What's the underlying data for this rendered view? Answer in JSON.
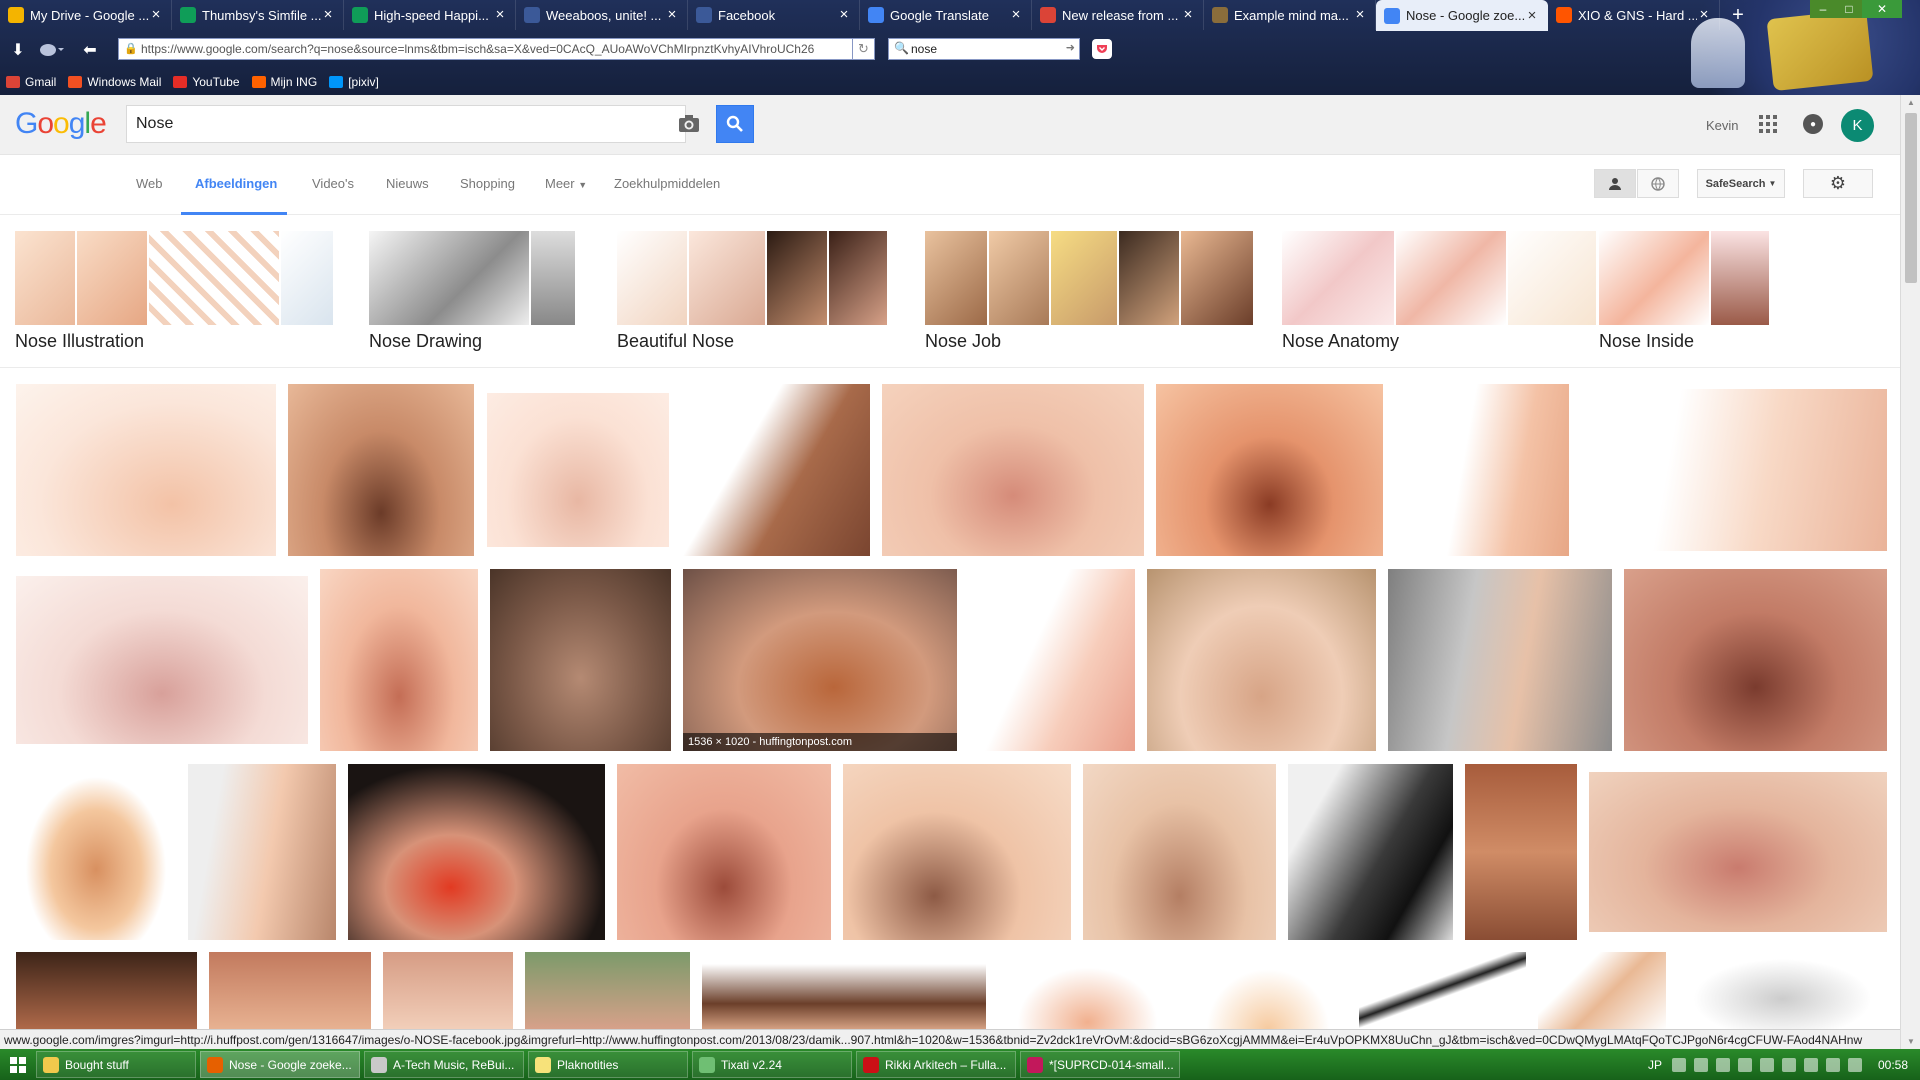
{
  "browser": {
    "tabs": [
      {
        "label": "My Drive - Google ...",
        "icon": "drive-icon",
        "color": "#f4b400"
      },
      {
        "label": "Thumbsy's Simfile ...",
        "icon": "sheet-icon",
        "color": "#0f9d58"
      },
      {
        "label": "High-speed Happi...",
        "icon": "sheet-icon",
        "color": "#0f9d58"
      },
      {
        "label": "Weeaboos, unite! ...",
        "icon": "facebook-icon",
        "color": "#3b5998"
      },
      {
        "label": "Facebook",
        "icon": "facebook-icon",
        "color": "#3b5998"
      },
      {
        "label": "Google Translate",
        "icon": "translate-icon",
        "color": "#4285f4"
      },
      {
        "label": "New release from ...",
        "icon": "gmail-icon",
        "color": "#db4437"
      },
      {
        "label": "Example mind ma...",
        "icon": "image-icon",
        "color": "#8a6d3b"
      },
      {
        "label": "Nose - Google zoe...",
        "icon": "google-icon",
        "color": "#4285f4",
        "active": true
      },
      {
        "label": "XIO & GNS - Hard ...",
        "icon": "soundcloud-icon",
        "color": "#ff5500"
      }
    ],
    "url": "https://www.google.com/search?q=nose&source=lnms&tbm=isch&sa=X&ved=0CAcQ_AUoAWoVChMIrpnztKvhyAIVhroUCh26",
    "search_value": "nose",
    "bookmarks": [
      {
        "label": "Gmail",
        "icon": "gmail-icon",
        "color": "#db4437"
      },
      {
        "label": "Windows Mail",
        "icon": "windows-icon",
        "color": "#f25022"
      },
      {
        "label": "YouTube",
        "icon": "youtube-icon",
        "color": "#e52d27"
      },
      {
        "label": "Mijn ING",
        "icon": "ing-icon",
        "color": "#ff6200"
      },
      {
        "label": "[pixiv]",
        "icon": "pixiv-icon",
        "color": "#0096fa"
      }
    ]
  },
  "google": {
    "query": "Nose",
    "user_name": "Kevin",
    "avatar_letter": "K",
    "nav": [
      "Web",
      "Afbeeldingen",
      "Video's",
      "Nieuws",
      "Shopping",
      "Meer",
      "Zoekhulpmiddelen"
    ],
    "safesearch_label": "SafeSearch"
  },
  "related": [
    {
      "label": "Nose Illustration"
    },
    {
      "label": "Nose Drawing"
    },
    {
      "label": "Beautiful Nose"
    },
    {
      "label": "Nose Job"
    },
    {
      "label": "Nose Anatomy"
    },
    {
      "label": "Nose Inside"
    }
  ],
  "image_caption": "1536 × 1020 - huffingtonpost.com",
  "status_url": "www.google.com/imgres?imgurl=http://i.huffpost.com/gen/1316647/images/o-NOSE-facebook.jpg&imgrefurl=http://www.huffingtonpost.com/2013/08/23/damik...907.html&h=1020&w=1536&tbnid=Zv2dck1reVrOvM:&docid=sBG6zoXcgjAMMM&ei=Er4uVpOPKMX8UuChn_gJ&tbm=isch&ved=0CDwQMygLMAtqFQoTCJPgoN6r4cgCFUW-FAod4NAHnw",
  "taskbar": {
    "items": [
      {
        "label": "Bought stuff",
        "icon": "folder-icon",
        "color": "#f2c94c"
      },
      {
        "label": "Nose - Google zoeke...",
        "icon": "firefox-icon",
        "color": "#e66000",
        "active": true
      },
      {
        "label": "A-Tech Music, ReBui...",
        "icon": "app-icon",
        "color": "#c9c9c9"
      },
      {
        "label": "Plaknotities",
        "icon": "sticky-notes-icon",
        "color": "#f7e27a"
      },
      {
        "label": "Tixati v2.24",
        "icon": "tixati-icon",
        "color": "#6fbf73"
      },
      {
        "label": "Rikki Arkitech – Fulla...",
        "icon": "opera-icon",
        "color": "#cc0f16"
      },
      {
        "label": "*[SUPRCD-014-small...",
        "icon": "editor-icon",
        "color": "#c2185b"
      }
    ],
    "lang": "JP",
    "time": "00:58"
  }
}
